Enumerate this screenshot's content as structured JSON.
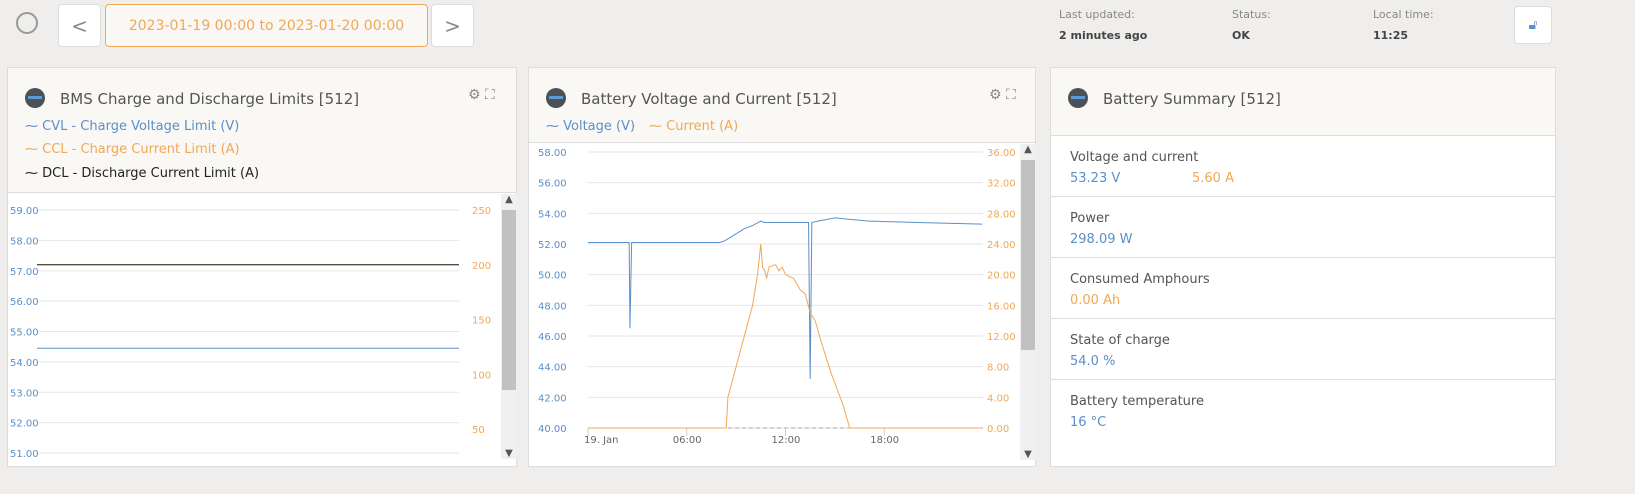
{
  "toolbar": {
    "date_range": "2023-01-19 00:00 to 2023-01-20 00:00",
    "prev": "<",
    "next": ">"
  },
  "status": {
    "last_updated_label": "Last updated:",
    "last_updated": "2 minutes ago",
    "status_label": "Status:",
    "status": "OK",
    "local_time_label": "Local time:",
    "local_time": "11:25"
  },
  "colors": {
    "blue": "#5b8fc7",
    "orange": "#f0a856",
    "black": "#222222"
  },
  "panels": {
    "bms": {
      "title": "BMS Charge and Discharge Limits [512]",
      "legend": [
        "CVL - Charge Voltage Limit (V)",
        "CCL - Charge Current Limit (A)",
        "DCL - Discharge Current Limit (A)"
      ]
    },
    "vc": {
      "title": "Battery Voltage and Current [512]",
      "legend": [
        "Voltage (V)",
        "Current (A)"
      ]
    },
    "summary": {
      "title": "Battery Summary [512]",
      "rows": [
        {
          "label": "Voltage and current",
          "values": [
            "53.23 V",
            "5.60 A"
          ]
        },
        {
          "label": "Power",
          "values": [
            "298.09 W"
          ]
        },
        {
          "label": "Consumed Amphours",
          "values": [
            "0.00 Ah"
          ]
        },
        {
          "label": "State of charge",
          "values": [
            "54.0 %"
          ]
        },
        {
          "label": "Battery temperature",
          "values": [
            "16 °C"
          ]
        }
      ]
    }
  },
  "chart_data": [
    {
      "type": "line",
      "title": "BMS Charge and Discharge Limits [512]",
      "ylim": [
        51,
        59
      ],
      "y2lim": [
        40,
        250
      ],
      "yticks": [
        "59.00",
        "58.00",
        "57.00",
        "56.00",
        "55.00",
        "54.00",
        "53.00",
        "52.00",
        "51.00"
      ],
      "y2ticks": [
        "250",
        "200",
        "150",
        "100",
        "50"
      ],
      "series": [
        {
          "name": "CVL - Charge Voltage Limit (V)",
          "axis": "left",
          "x": [
            0,
            24
          ],
          "y": [
            54.45,
            54.45
          ]
        },
        {
          "name": "CCL - Charge Current Limit (A)",
          "axis": "right",
          "x": [
            0,
            24
          ],
          "y": [
            200,
            200
          ]
        },
        {
          "name": "DCL - Discharge Current Limit (A)",
          "axis": "right",
          "x": [
            0,
            24
          ],
          "y": [
            200,
            200
          ]
        }
      ]
    },
    {
      "type": "line",
      "title": "Battery Voltage and Current [512]",
      "xlim": [
        0,
        24
      ],
      "ylim": [
        40,
        58
      ],
      "y2lim": [
        0,
        36
      ],
      "xticks": [
        "19. Jan",
        "06:00",
        "12:00",
        "18:00"
      ],
      "yticks": [
        "58.00",
        "56.00",
        "54.00",
        "52.00",
        "50.00",
        "48.00",
        "46.00",
        "44.00",
        "42.00",
        "40.00"
      ],
      "y2ticks": [
        "36.00",
        "32.00",
        "28.00",
        "24.00",
        "20.00",
        "16.00",
        "12.00",
        "8.00",
        "4.00",
        "0.00"
      ],
      "series": [
        {
          "name": "Voltage (V)",
          "axis": "left",
          "x": [
            0,
            2.5,
            2.55,
            2.65,
            8,
            8.3,
            9.5,
            10,
            10.5,
            10.7,
            13.4,
            13.5,
            13.6,
            14,
            15,
            16,
            17,
            20,
            23.95
          ],
          "y": [
            52.1,
            52.1,
            46.5,
            52.1,
            52.1,
            52.2,
            53.0,
            53.2,
            53.5,
            53.4,
            53.4,
            43.2,
            53.4,
            53.5,
            53.7,
            53.6,
            53.5,
            53.4,
            53.3
          ]
        },
        {
          "name": "Current (A)",
          "axis": "right",
          "x": [
            0,
            8.4,
            8.5,
            9,
            9.5,
            10,
            10.3,
            10.5,
            10.6,
            10.75,
            10.85,
            11,
            11.4,
            11.6,
            11.8,
            12,
            12.5,
            12.9,
            13.2,
            13.5,
            13.8,
            14.2,
            14.8,
            15.5,
            15.9,
            23.95
          ],
          "y": [
            0,
            0,
            4,
            8,
            12,
            16,
            20,
            24,
            21,
            20.5,
            19.5,
            21,
            21.3,
            20.5,
            21,
            20,
            19.5,
            18,
            17.5,
            15,
            14,
            11,
            7,
            3,
            0,
            0
          ]
        }
      ]
    }
  ]
}
